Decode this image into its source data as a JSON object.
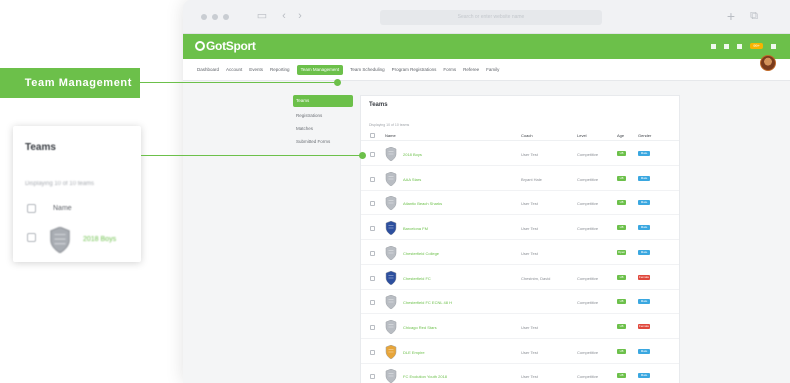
{
  "browser": {
    "url": "Search or enter website name"
  },
  "app": {
    "logo": "GotSport",
    "notification_badge": "99+",
    "colors": {
      "brand_green": "#6cc04a",
      "badge_orange": "#f6b400",
      "blue": "#3aa7e0",
      "red": "#e0483c"
    }
  },
  "nav": {
    "items": [
      {
        "label": "Dashboard",
        "icon": "home-icon"
      },
      {
        "label": "Account",
        "icon": "user-icon"
      },
      {
        "label": "Events",
        "icon": "calendar-icon"
      },
      {
        "label": "Reporting",
        "icon": "chart-icon"
      },
      {
        "label": "Team Management",
        "icon": "shield-icon"
      },
      {
        "label": "Team Scheduling",
        "icon": "grid-icon"
      },
      {
        "label": "Program Registrations",
        "icon": "tag-icon"
      },
      {
        "label": "Forms",
        "icon": "document-icon"
      },
      {
        "label": "Referee",
        "icon": "whistle-icon"
      },
      {
        "label": "Family",
        "icon": "family-icon"
      }
    ]
  },
  "sidebar": {
    "items": [
      {
        "label": "Teams"
      },
      {
        "label": "Registrations"
      },
      {
        "label": "Matches"
      },
      {
        "label": "Submitted Forms"
      }
    ]
  },
  "teams": {
    "title": "Teams",
    "showing": "Displaying 10 of 10 teams",
    "columns": {
      "name": "Name",
      "coach": "Coach",
      "level": "Level",
      "age": "Age",
      "gender": "Gender"
    },
    "rows": [
      {
        "name": "2018 Boys",
        "coach": "User Test",
        "level": "Competitive",
        "age": "U8",
        "gender": "Male",
        "gender_color": "#3aa7e0",
        "age_color": "#6cc04a"
      },
      {
        "name": "AAA Stars",
        "coach": "Bryant Hale",
        "level": "Competitive",
        "age": "U8",
        "gender": "Male",
        "gender_color": "#3aa7e0",
        "age_color": "#6cc04a"
      },
      {
        "name": "Atlantic Beach Sharks",
        "coach": "User Test",
        "level": "Competitive",
        "age": "U8",
        "gender": "Male",
        "gender_color": "#3aa7e0",
        "age_color": "#6cc04a"
      },
      {
        "name": "Barcelona FM",
        "coach": "User Test",
        "level": "Competitive",
        "age": "U8",
        "gender": "Male",
        "gender_color": "#3aa7e0",
        "age_color": "#6cc04a"
      },
      {
        "name": "Chesterfield College",
        "coach": "User Test",
        "level": "",
        "age": "Open",
        "gender": "Male",
        "gender_color": "#3aa7e0",
        "age_color": "#6cc04a"
      },
      {
        "name": "Chesterfield FC",
        "coach": "Chestnim, David",
        "level": "Competitive",
        "age": "U8",
        "gender": "Female",
        "gender_color": "#e0483c",
        "age_color": "#6cc04a"
      },
      {
        "name": "Chesterfield FC ECNL 48 H",
        "coach": "",
        "level": "Competitive",
        "age": "U8",
        "gender": "Male",
        "gender_color": "#3aa7e0",
        "age_color": "#6cc04a"
      },
      {
        "name": "Chicago Red Stars",
        "coach": "User Test",
        "level": "",
        "age": "U8",
        "gender": "Female",
        "gender_color": "#e0483c",
        "age_color": "#6cc04a"
      },
      {
        "name": "DLE Empire",
        "coach": "User Test",
        "level": "Competitive",
        "age": "U8",
        "gender": "Male",
        "gender_color": "#3aa7e0",
        "age_color": "#6cc04a"
      },
      {
        "name": "FC Evolution Youth 2018",
        "coach": "User Test",
        "level": "Competitive",
        "age": "U8",
        "gender": "Male",
        "gender_color": "#3aa7e0",
        "age_color": "#6cc04a"
      }
    ]
  },
  "callouts": {
    "nav_label": "Team Management",
    "zoom": {
      "title": "Teams",
      "showing": "Displaying 10 of 10 teams",
      "name_header": "Name",
      "row_name": "2018 Boys"
    }
  }
}
